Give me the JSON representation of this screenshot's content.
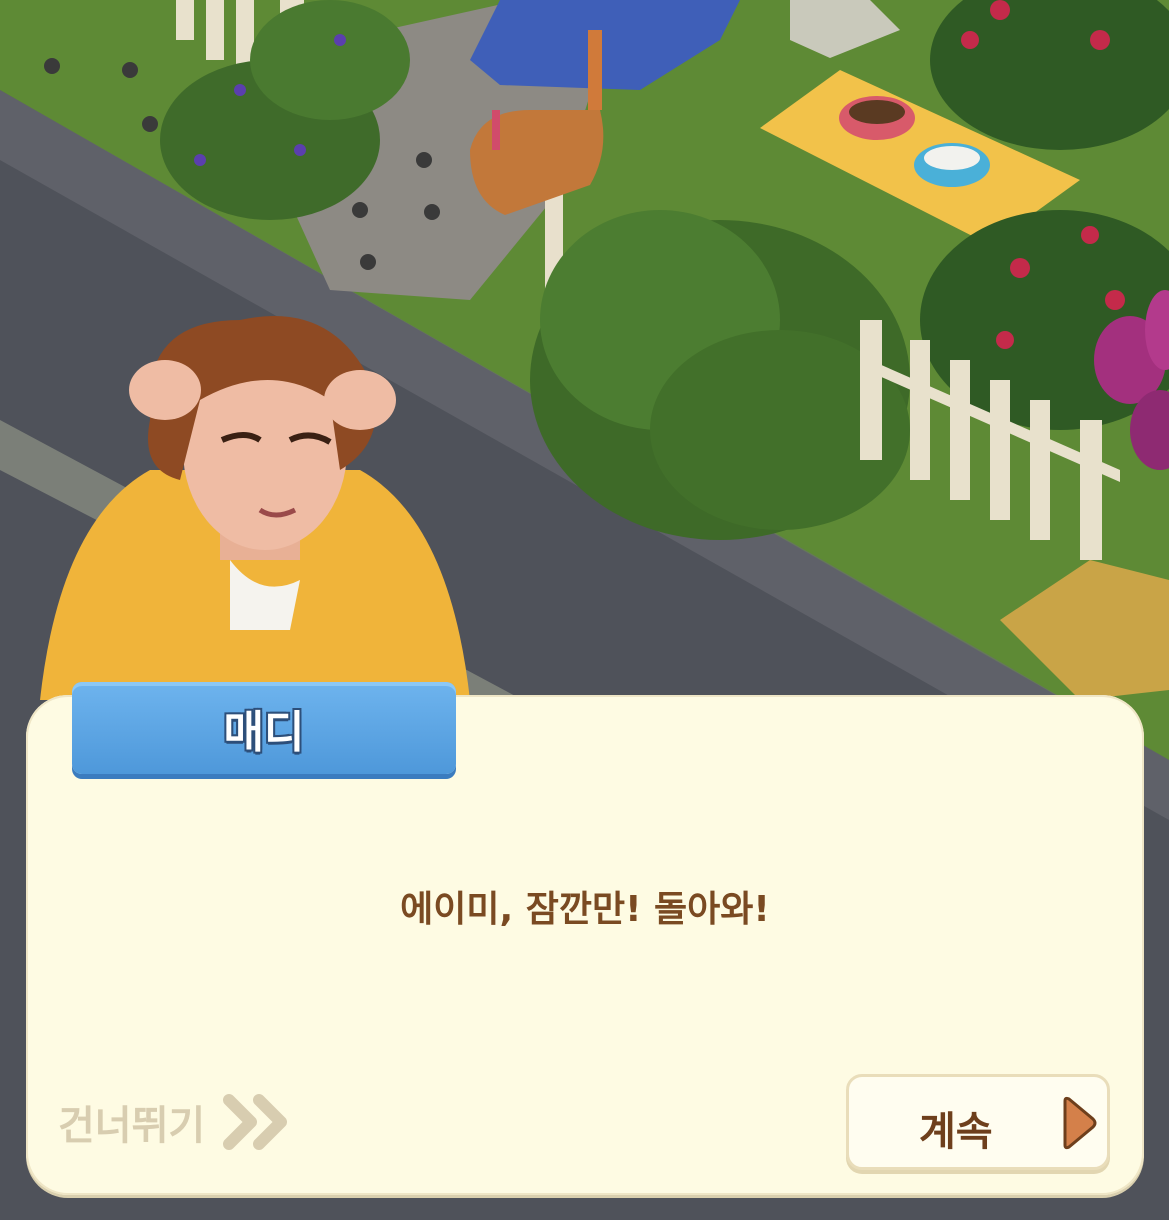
{
  "speaker": {
    "name": "매디"
  },
  "dialog": {
    "line": "에이미, 잠깐만! 돌아와!"
  },
  "controls": {
    "skip_label": "건너뛰기",
    "skip_icon": "double-chevron-right-icon",
    "continue_label": "계속",
    "continue_icon": "play-triangle-icon"
  },
  "colors": {
    "name_tab": "#5aa6e6",
    "dialog_bg": "#fefbe3",
    "text_brown": "#7a4a22"
  }
}
